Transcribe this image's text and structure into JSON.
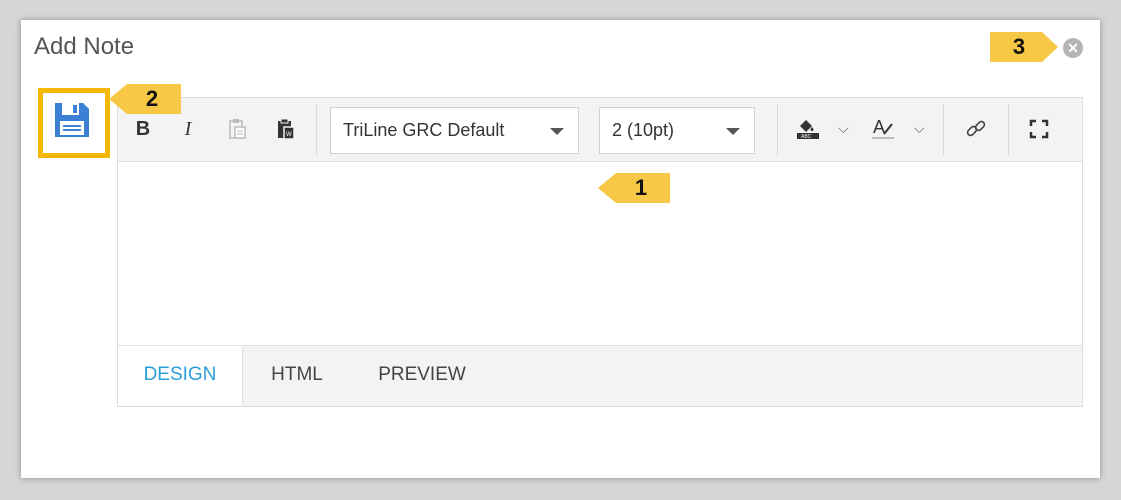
{
  "dialog": {
    "title": "Add Note",
    "close_icon": "x-circle-icon"
  },
  "save_button": {
    "icon": "floppy-disk-icon"
  },
  "toolbar": {
    "bold_label": "B",
    "italic_label": "I",
    "copy_icon": "clipboard-copy-icon",
    "paste_icon": "clipboard-paste-icon",
    "font_family": "TriLine GRC Default",
    "font_size": "2 (10pt)",
    "highlight_color_icon": "background-color-icon",
    "font_color_icon": "font-color-icon",
    "link_icon": "link-icon",
    "fullscreen_icon": "fullscreen-icon"
  },
  "tabs": [
    {
      "label": "DESIGN"
    },
    {
      "label": "HTML"
    },
    {
      "label": "PREVIEW"
    }
  ],
  "callouts": {
    "one": "1",
    "two": "2",
    "three": "3"
  },
  "colors": {
    "accent": "#2b9fd9",
    "callout": "#f7c845",
    "highlight_border": "#f5b800",
    "save_icon": "#3b7fd6"
  }
}
